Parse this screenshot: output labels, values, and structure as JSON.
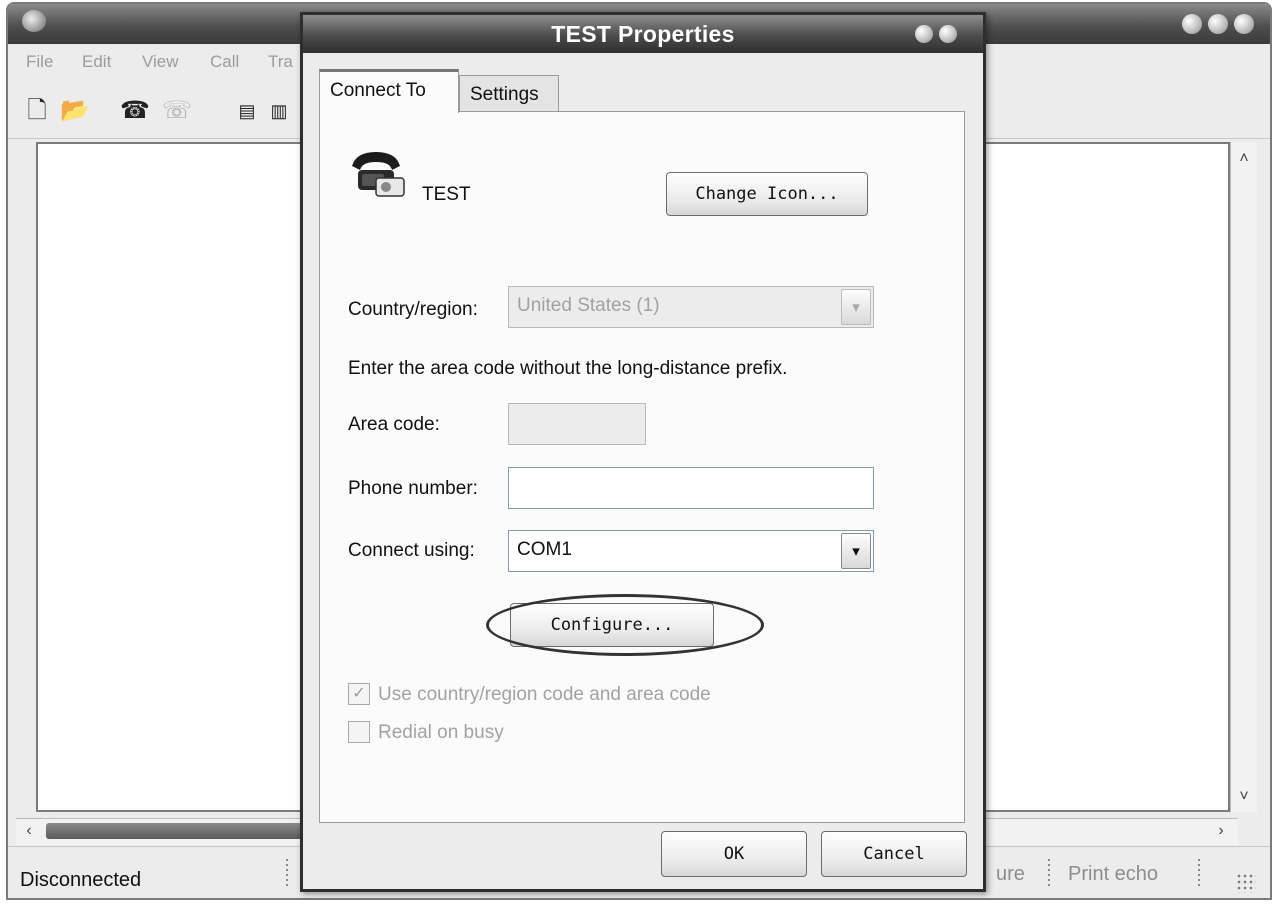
{
  "background_window": {
    "menu": [
      "File",
      "Edit",
      "View",
      "Call",
      "Tra"
    ],
    "status": {
      "connection": "Disconnected",
      "capture": "ure",
      "print_echo": "Print echo"
    }
  },
  "dialog": {
    "title": "TEST Properties",
    "tabs": [
      {
        "label": "Connect To",
        "active": true
      },
      {
        "label": "Settings",
        "active": false
      }
    ],
    "connection_name": "TEST",
    "change_icon_label": "Change Icon...",
    "country_label": "Country/region:",
    "country_value": "United States (1)",
    "instruction": "Enter the area code without the long-distance prefix.",
    "area_code_label": "Area code:",
    "area_code_value": "",
    "phone_label": "Phone number:",
    "phone_value": "",
    "connect_using_label": "Connect using:",
    "connect_using_value": "COM1",
    "configure_label": "Configure...",
    "use_country_code_label": "Use country/region code and area code",
    "use_country_code_checked": true,
    "redial_label": "Redial on busy",
    "redial_checked": false,
    "ok_label": "OK",
    "cancel_label": "Cancel"
  }
}
